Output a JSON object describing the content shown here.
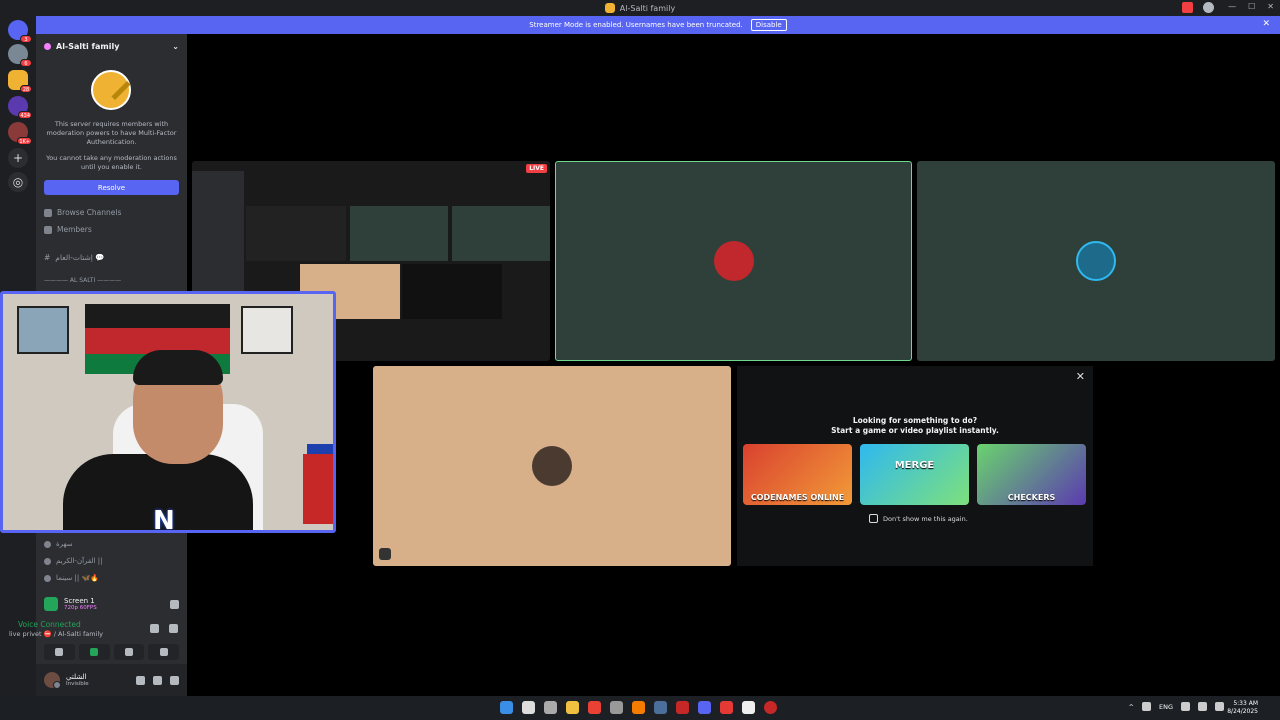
{
  "window": {
    "title": "Al-Salti family"
  },
  "streamer_bar": {
    "text": "Streamer Mode is enabled. Usernames have been truncated.",
    "disable_label": "Disable"
  },
  "guilds": [
    {
      "badge": "3"
    },
    {
      "badge": "6"
    },
    {
      "badge": "28"
    },
    {
      "badge": "434"
    },
    {
      "badge": "1K+"
    }
  ],
  "server": {
    "name": "Al-Salti family",
    "mfa_notice": "This server requires members with moderation powers to have Multi-Factor Authentication.",
    "mfa_notice2": "You cannot take any moderation actions until you enable it.",
    "resolve_label": "Resolve",
    "browse_channels": "Browse Channels",
    "members": "Members",
    "text_channel": "إشتات-العام 💬",
    "category": "———— AL SALTI ————",
    "voice_channels": [
      "سهرة",
      "القرآن-الكريم ||",
      "سينما || 🦋🔥"
    ]
  },
  "stream_panel": {
    "title": "Screen 1",
    "quality": "720p 60FPS"
  },
  "voice": {
    "status": "Voice Connected",
    "channel": "live privet ⛔ / Al-Salti family"
  },
  "user": {
    "name": "الشلتي",
    "status": "Invisible"
  },
  "stage": {
    "live_label": "LIVE"
  },
  "activity": {
    "heading_line1": "Looking for something to do?",
    "heading_line2": "Start a game or video playlist instantly.",
    "games": [
      "CODENAMES ONLINE",
      "MERGE",
      "CHECKERS"
    ],
    "dont_show": "Don't show me this again."
  },
  "taskbar": {
    "lang": "ENG",
    "time": "5:33 AM",
    "date": "8/24/2025"
  }
}
